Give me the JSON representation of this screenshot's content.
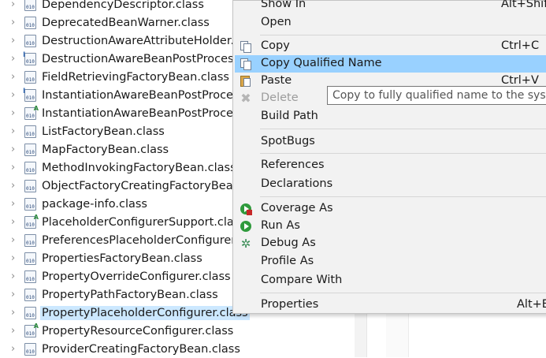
{
  "tree": {
    "items": [
      {
        "name": "DependencyDescriptor.class",
        "mark": ""
      },
      {
        "name": "DeprecatedBeanWarner.class",
        "mark": ""
      },
      {
        "name": "DestructionAwareAttributeHolder.cla",
        "mark": ""
      },
      {
        "name": "DestructionAwareBeanPostProcesso",
        "mark": "I"
      },
      {
        "name": "FieldRetrievingFactoryBean.class",
        "mark": ""
      },
      {
        "name": "InstantiationAwareBeanPostProcesso",
        "mark": "I"
      },
      {
        "name": "InstantiationAwareBeanPostProcesso",
        "mark": "A"
      },
      {
        "name": "ListFactoryBean.class",
        "mark": ""
      },
      {
        "name": "MapFactoryBean.class",
        "mark": ""
      },
      {
        "name": "MethodInvokingFactoryBean.class",
        "mark": ""
      },
      {
        "name": "ObjectFactoryCreatingFactoryBean.c",
        "mark": ""
      },
      {
        "name": "package-info.class",
        "mark": ""
      },
      {
        "name": "PlaceholderConfigurerSupport.class",
        "mark": "A"
      },
      {
        "name": "PreferencesPlaceholderConfigurer.c",
        "mark": ""
      },
      {
        "name": "PropertiesFactoryBean.class",
        "mark": ""
      },
      {
        "name": "PropertyOverrideConfigurer.class",
        "mark": ""
      },
      {
        "name": "PropertyPathFactoryBean.class",
        "mark": ""
      },
      {
        "name": "PropertyPlaceholderConfigurer.class",
        "mark": ""
      },
      {
        "name": "PropertyResourceConfigurer.class",
        "mark": "A"
      },
      {
        "name": "ProviderCreatingFactoryBean.class",
        "mark": ""
      }
    ],
    "selected_index": 17,
    "file_icon_text": "010"
  },
  "menu": {
    "show_in": {
      "label": "Show In",
      "shortcut": "Alt+Shift+W"
    },
    "open": {
      "label": "Open"
    },
    "copy": {
      "label": "Copy",
      "shortcut": "Ctrl+C"
    },
    "copy_qualified_name": {
      "label": "Copy Qualified Name"
    },
    "paste": {
      "label": "Paste",
      "shortcut": "Ctrl+V"
    },
    "delete": {
      "label": "Delete"
    },
    "build_path": {
      "label": "Build Path"
    },
    "spotbugs": {
      "label": "SpotBugs"
    },
    "references": {
      "label": "References"
    },
    "declarations": {
      "label": "Declarations"
    },
    "coverage_as": {
      "label": "Coverage As"
    },
    "run_as": {
      "label": "Run As"
    },
    "debug_as": {
      "label": "Debug As"
    },
    "profile_as": {
      "label": "Profile As"
    },
    "compare_with": {
      "label": "Compare With"
    },
    "properties": {
      "label": "Properties",
      "shortcut": "Alt+Enter"
    }
  },
  "tooltip": {
    "text": "Copy to fully qualified name to the system clipboard"
  },
  "colors": {
    "highlight": "#99d1ff",
    "tree_selection": "#cce8ff",
    "run_green": "#2f9a3c"
  }
}
